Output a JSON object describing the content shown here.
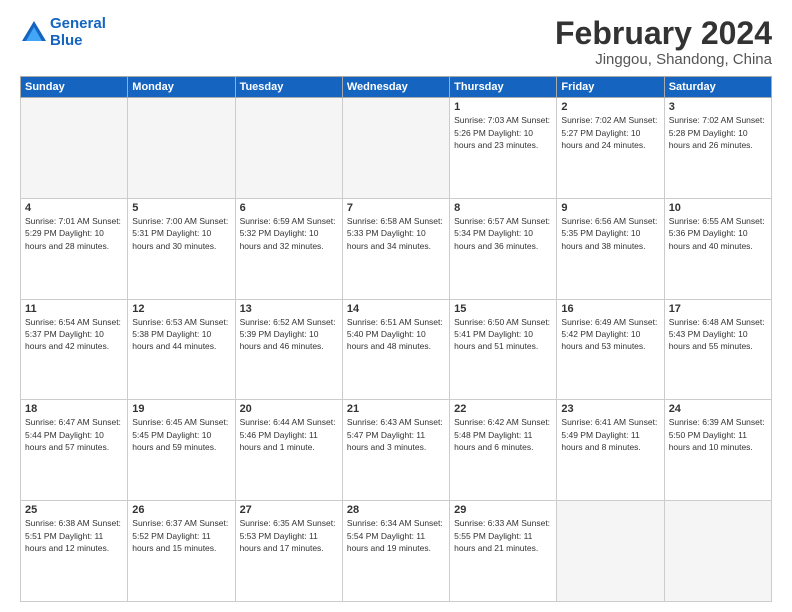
{
  "header": {
    "logo_line1": "General",
    "logo_line2": "Blue",
    "month": "February 2024",
    "location": "Jinggou, Shandong, China"
  },
  "weekdays": [
    "Sunday",
    "Monday",
    "Tuesday",
    "Wednesday",
    "Thursday",
    "Friday",
    "Saturday"
  ],
  "weeks": [
    [
      {
        "day": "",
        "detail": ""
      },
      {
        "day": "",
        "detail": ""
      },
      {
        "day": "",
        "detail": ""
      },
      {
        "day": "",
        "detail": ""
      },
      {
        "day": "1",
        "detail": "Sunrise: 7:03 AM\nSunset: 5:26 PM\nDaylight: 10 hours\nand 23 minutes."
      },
      {
        "day": "2",
        "detail": "Sunrise: 7:02 AM\nSunset: 5:27 PM\nDaylight: 10 hours\nand 24 minutes."
      },
      {
        "day": "3",
        "detail": "Sunrise: 7:02 AM\nSunset: 5:28 PM\nDaylight: 10 hours\nand 26 minutes."
      }
    ],
    [
      {
        "day": "4",
        "detail": "Sunrise: 7:01 AM\nSunset: 5:29 PM\nDaylight: 10 hours\nand 28 minutes."
      },
      {
        "day": "5",
        "detail": "Sunrise: 7:00 AM\nSunset: 5:31 PM\nDaylight: 10 hours\nand 30 minutes."
      },
      {
        "day": "6",
        "detail": "Sunrise: 6:59 AM\nSunset: 5:32 PM\nDaylight: 10 hours\nand 32 minutes."
      },
      {
        "day": "7",
        "detail": "Sunrise: 6:58 AM\nSunset: 5:33 PM\nDaylight: 10 hours\nand 34 minutes."
      },
      {
        "day": "8",
        "detail": "Sunrise: 6:57 AM\nSunset: 5:34 PM\nDaylight: 10 hours\nand 36 minutes."
      },
      {
        "day": "9",
        "detail": "Sunrise: 6:56 AM\nSunset: 5:35 PM\nDaylight: 10 hours\nand 38 minutes."
      },
      {
        "day": "10",
        "detail": "Sunrise: 6:55 AM\nSunset: 5:36 PM\nDaylight: 10 hours\nand 40 minutes."
      }
    ],
    [
      {
        "day": "11",
        "detail": "Sunrise: 6:54 AM\nSunset: 5:37 PM\nDaylight: 10 hours\nand 42 minutes."
      },
      {
        "day": "12",
        "detail": "Sunrise: 6:53 AM\nSunset: 5:38 PM\nDaylight: 10 hours\nand 44 minutes."
      },
      {
        "day": "13",
        "detail": "Sunrise: 6:52 AM\nSunset: 5:39 PM\nDaylight: 10 hours\nand 46 minutes."
      },
      {
        "day": "14",
        "detail": "Sunrise: 6:51 AM\nSunset: 5:40 PM\nDaylight: 10 hours\nand 48 minutes."
      },
      {
        "day": "15",
        "detail": "Sunrise: 6:50 AM\nSunset: 5:41 PM\nDaylight: 10 hours\nand 51 minutes."
      },
      {
        "day": "16",
        "detail": "Sunrise: 6:49 AM\nSunset: 5:42 PM\nDaylight: 10 hours\nand 53 minutes."
      },
      {
        "day": "17",
        "detail": "Sunrise: 6:48 AM\nSunset: 5:43 PM\nDaylight: 10 hours\nand 55 minutes."
      }
    ],
    [
      {
        "day": "18",
        "detail": "Sunrise: 6:47 AM\nSunset: 5:44 PM\nDaylight: 10 hours\nand 57 minutes."
      },
      {
        "day": "19",
        "detail": "Sunrise: 6:45 AM\nSunset: 5:45 PM\nDaylight: 10 hours\nand 59 minutes."
      },
      {
        "day": "20",
        "detail": "Sunrise: 6:44 AM\nSunset: 5:46 PM\nDaylight: 11 hours\nand 1 minute."
      },
      {
        "day": "21",
        "detail": "Sunrise: 6:43 AM\nSunset: 5:47 PM\nDaylight: 11 hours\nand 3 minutes."
      },
      {
        "day": "22",
        "detail": "Sunrise: 6:42 AM\nSunset: 5:48 PM\nDaylight: 11 hours\nand 6 minutes."
      },
      {
        "day": "23",
        "detail": "Sunrise: 6:41 AM\nSunset: 5:49 PM\nDaylight: 11 hours\nand 8 minutes."
      },
      {
        "day": "24",
        "detail": "Sunrise: 6:39 AM\nSunset: 5:50 PM\nDaylight: 11 hours\nand 10 minutes."
      }
    ],
    [
      {
        "day": "25",
        "detail": "Sunrise: 6:38 AM\nSunset: 5:51 PM\nDaylight: 11 hours\nand 12 minutes."
      },
      {
        "day": "26",
        "detail": "Sunrise: 6:37 AM\nSunset: 5:52 PM\nDaylight: 11 hours\nand 15 minutes."
      },
      {
        "day": "27",
        "detail": "Sunrise: 6:35 AM\nSunset: 5:53 PM\nDaylight: 11 hours\nand 17 minutes."
      },
      {
        "day": "28",
        "detail": "Sunrise: 6:34 AM\nSunset: 5:54 PM\nDaylight: 11 hours\nand 19 minutes."
      },
      {
        "day": "29",
        "detail": "Sunrise: 6:33 AM\nSunset: 5:55 PM\nDaylight: 11 hours\nand 21 minutes."
      },
      {
        "day": "",
        "detail": ""
      },
      {
        "day": "",
        "detail": ""
      }
    ]
  ]
}
